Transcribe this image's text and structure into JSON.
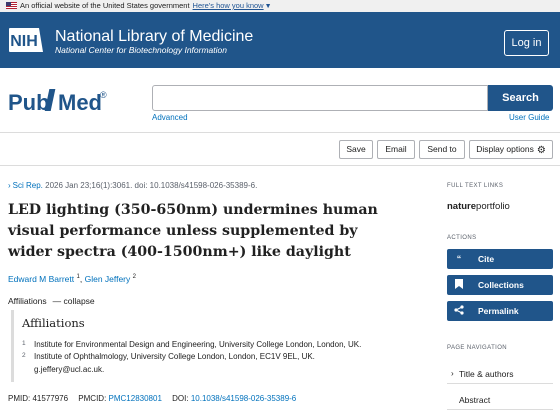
{
  "banner": {
    "text": "An official website of the United States government",
    "link": "Here's how you know"
  },
  "header": {
    "logo_text": "NIH",
    "title": "National Library of Medicine",
    "subtitle": "National Center for Biotechnology Information",
    "login_label": "Log in"
  },
  "search": {
    "logo_pub": "Pub",
    "logo_med": "Med",
    "logo_reg": "®",
    "placeholder": "",
    "button_label": "Search",
    "advanced_label": "Advanced",
    "userguide_label": "User Guide"
  },
  "toolbar": {
    "save_label": "Save",
    "email_label": "Email",
    "sendto_label": "Send to",
    "display_label": "Display options"
  },
  "article": {
    "journal": "Sci Rep.",
    "citation": "2026 Jan 23;16(1):3061. doi: 10.1038/s41598-026-35389-6.",
    "title": "LED lighting (350-650nm) undermines human visual performance unless supplemented by wider spectra (400-1500nm+) like daylight",
    "authors": [
      {
        "name": "Edward M Barrett",
        "sup": "1"
      },
      {
        "name": "Glen Jeffery",
        "sup": "2"
      }
    ],
    "affiliations_label": "Affiliations",
    "collapse_label": "collapse",
    "affiliations_heading": "Affiliations",
    "affiliations": [
      {
        "num": "1",
        "text": "Institute for Environmental Design and Engineering, University College London, London, UK."
      },
      {
        "num": "2",
        "text": "Institute of Ophthalmology, University College London, London, EC1V 9EL, UK."
      }
    ],
    "email": "g.jeffery@ucl.ac.uk.",
    "pmid_label": "PMID:",
    "pmid": "41577976",
    "pmcid_label": "PMCID:",
    "pmcid": "PMC12830801",
    "doi_label": "DOI:",
    "doi": "10.1038/s41598-026-35389-6"
  },
  "sidebar": {
    "fulltext_heading": "FULL TEXT LINKS",
    "publisher_bold": "nature",
    "publisher_rest": "portfolio",
    "actions_heading": "ACTIONS",
    "actions": [
      {
        "label": "Cite",
        "icon": "quote-icon"
      },
      {
        "label": "Collections",
        "icon": "bookmark-icon"
      },
      {
        "label": "Permalink",
        "icon": "share-icon"
      }
    ],
    "nav_heading": "PAGE NAVIGATION",
    "nav": [
      {
        "label": "Title & authors"
      },
      {
        "label": "Abstract"
      }
    ]
  },
  "colors": {
    "brand": "#20558a",
    "link": "#0071bc"
  }
}
